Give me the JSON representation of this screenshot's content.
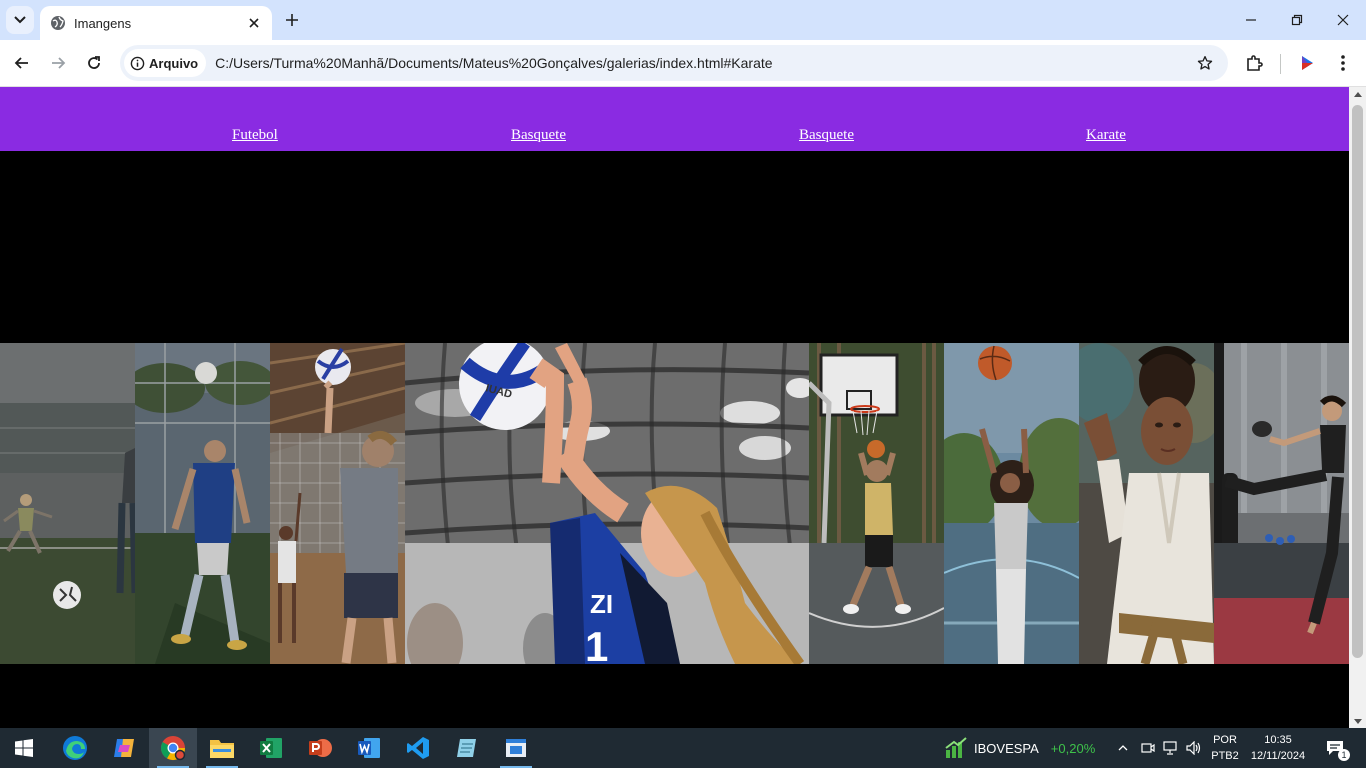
{
  "browser": {
    "tab_title": "Imangens",
    "site_chip_label": "Arquivo",
    "url": "C:/Users/Turma%20Manhã/Documents/Mateus%20Gonçalves/galerias/index.html#Karate"
  },
  "navbar": {
    "links": [
      "Futebol",
      "Basquete",
      "Basquete",
      "Karate"
    ],
    "background_color": "#8a2be2"
  },
  "gallery": {
    "photos": [
      "soccer-girls-kicking-ball",
      "soccer-player-heading-ball",
      "boy-volleyball-set",
      "girl-volleyball-set-expanded",
      "boy-basketball-shot",
      "girl-basketball-outdoor",
      "karate-girl-white-gi",
      "woman-kickboxing-kick"
    ]
  },
  "taskbar": {
    "apps": [
      "start",
      "edge",
      "copilot",
      "chrome",
      "file-explorer",
      "excel",
      "powerpoint",
      "word",
      "vscode",
      "notepad",
      "app"
    ],
    "ticker_name": "IBOVESPA",
    "ticker_change": "+0,20%",
    "language": "POR",
    "keyboard": "PTB2",
    "time": "10:35",
    "date": "12/11/2024",
    "notification_count": "1"
  }
}
